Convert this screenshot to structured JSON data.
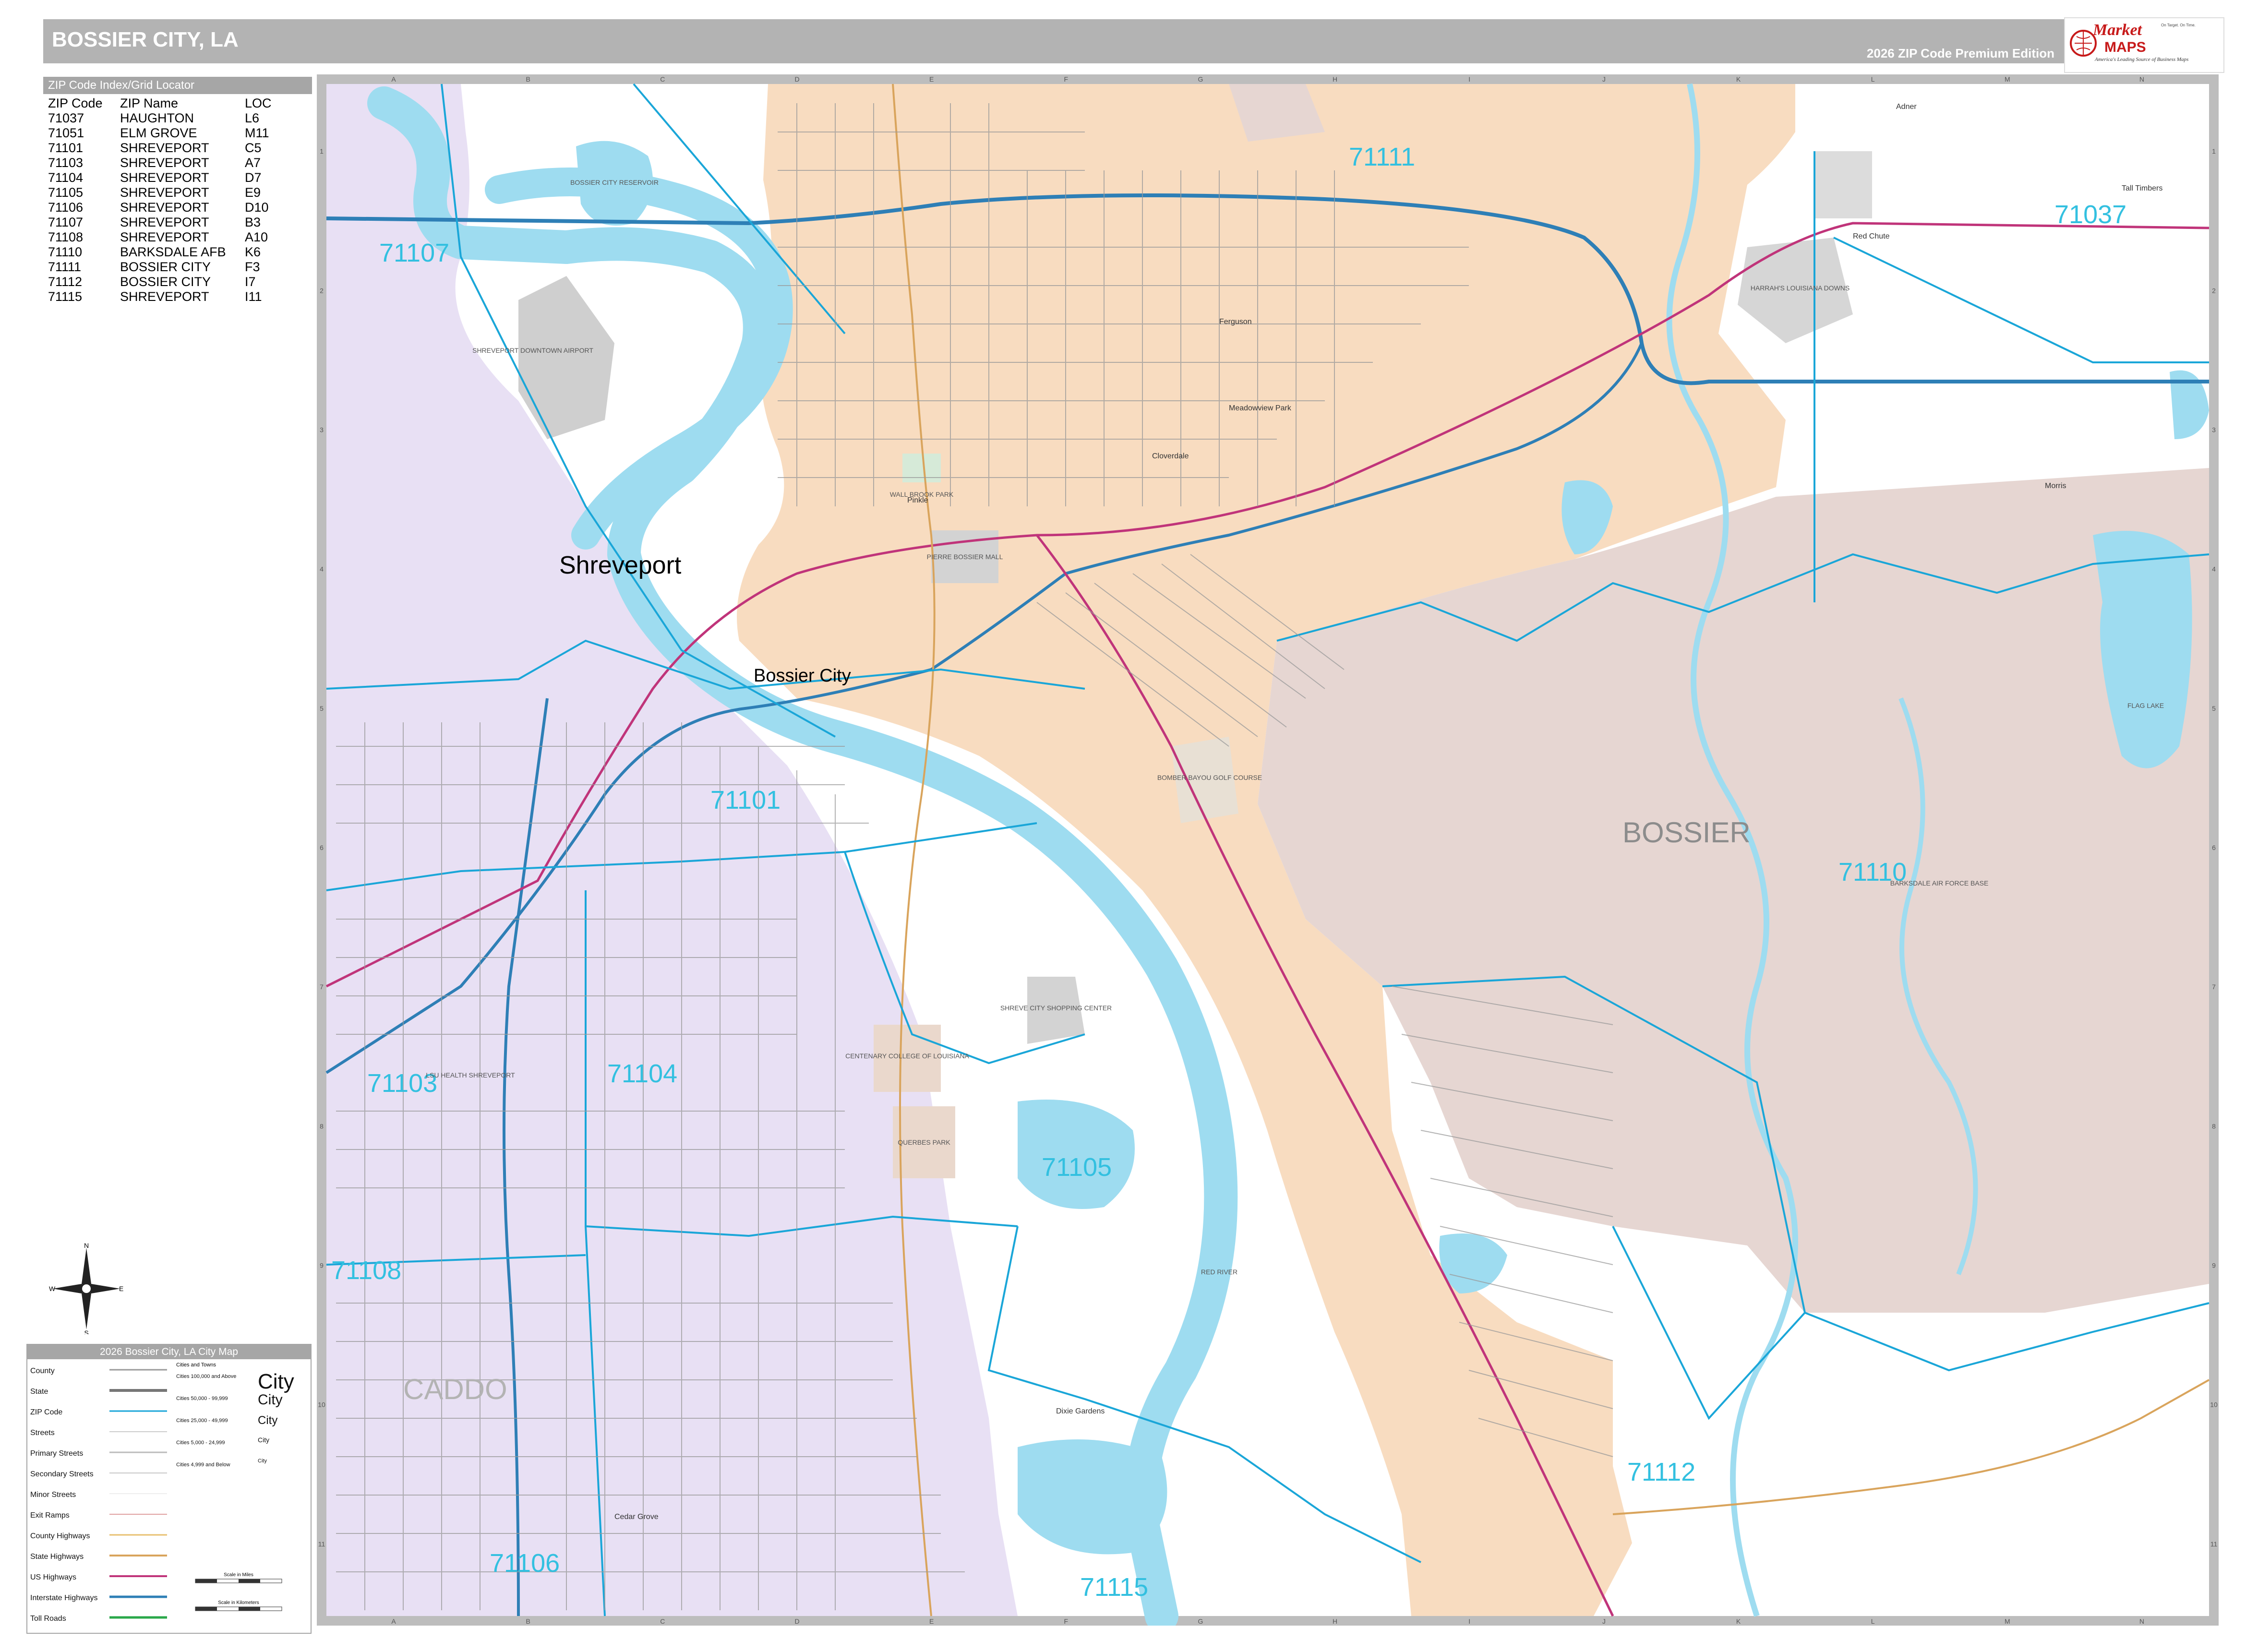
{
  "header": {
    "title": "BOSSIER CITY, LA",
    "edition": "2026 ZIP Code Premium Edition"
  },
  "brand": {
    "name_part1": "Market",
    "name_part2": "MAPS",
    "tagline": "America's Leading Source of Business Maps",
    "slogan": "On Target. On Time."
  },
  "zip_index": {
    "title": "ZIP Code Index/Grid Locator",
    "columns": [
      "ZIP Code",
      "ZIP Name",
      "LOC"
    ],
    "rows": [
      [
        "71037",
        "HAUGHTON",
        "L6"
      ],
      [
        "71051",
        "ELM GROVE",
        "M11"
      ],
      [
        "71101",
        "SHREVEPORT",
        "C5"
      ],
      [
        "71103",
        "SHREVEPORT",
        "A7"
      ],
      [
        "71104",
        "SHREVEPORT",
        "D7"
      ],
      [
        "71105",
        "SHREVEPORT",
        "E9"
      ],
      [
        "71106",
        "SHREVEPORT",
        "D10"
      ],
      [
        "71107",
        "SHREVEPORT",
        "B3"
      ],
      [
        "71108",
        "SHREVEPORT",
        "A10"
      ],
      [
        "71110",
        "BARKSDALE AFB",
        "K6"
      ],
      [
        "71111",
        "BOSSIER CITY",
        "F3"
      ],
      [
        "71112",
        "BOSSIER CITY",
        "I7"
      ],
      [
        "71115",
        "SHREVEPORT",
        "I11"
      ]
    ]
  },
  "map": {
    "colors": {
      "water": "#9edcf0",
      "shreveport_area": "#e8e0f4",
      "bossier_city_area": "#f8dcc0",
      "base_area": "#e6d6d2",
      "zip_boundary": "#1aa6d8",
      "interstate": "#2e7fb6",
      "us_highway": "#c0347a",
      "state_highway": "#d9a45c",
      "street": "#8c8c8c"
    },
    "grid_columns": [
      "A",
      "B",
      "C",
      "D",
      "E",
      "F",
      "G",
      "H",
      "I",
      "J",
      "K",
      "L",
      "M",
      "N"
    ],
    "grid_rows": [
      "1",
      "2",
      "3",
      "4",
      "5",
      "6",
      "7",
      "8",
      "9",
      "10",
      "11"
    ],
    "zip_labels": [
      "71111",
      "71037",
      "71107",
      "71101",
      "71110",
      "71103",
      "71104",
      "71105",
      "71108",
      "71112",
      "71106",
      "71115"
    ],
    "city_labels": [
      "Shreveport",
      "Bossier City"
    ],
    "county_labels": [
      "BOSSIER",
      "CADDO"
    ],
    "place_labels": [
      "Ferguson",
      "Meadowview Park",
      "Cloverdale",
      "Dixie Gardens",
      "Cedar Grove",
      "Red Chute",
      "Adner",
      "Tall Timbers",
      "Morris",
      "Pinkle"
    ],
    "landmark_labels": [
      "SHREVEPORT DOWNTOWN AIRPORT",
      "BOSSIER CITY RESERVOIR",
      "HARRAH'S LOUISIANA DOWNS",
      "BARKSDALE AIR FORCE BASE",
      "FLAG LAKE",
      "BOMBER BAYOU GOLF COURSE",
      "WALL BROOK PARK",
      "PIERRE BOSSIER MALL",
      "CENTENARY COLLEGE OF LOUISIANA",
      "SHREVE CITY SHOPPING CENTER",
      "QUERBES PARK",
      "LSU HEALTH SHREVEPORT",
      "RED RIVER"
    ]
  },
  "compass": {
    "north": "N",
    "south": "S",
    "east": "E",
    "west": "W"
  },
  "legend": {
    "title": "2026 Bossier City, LA City Map",
    "items": [
      "County",
      "State",
      "ZIP Code",
      "Streets",
      "Primary Streets",
      "Secondary Streets",
      "Minor Streets",
      "Exit Ramps",
      "County Highways",
      "State Highways",
      "US Highways",
      "Interstate Highways",
      "Toll Roads"
    ],
    "cities_header": "Cities and Towns",
    "cities": [
      {
        "desc": "Cities 100,000 and Above",
        "sample": "City"
      },
      {
        "desc": "Cities 50,000 - 99,999",
        "sample": "City"
      },
      {
        "desc": "Cities 25,000 - 49,999",
        "sample": "City"
      },
      {
        "desc": "Cities 5,000 - 24,999",
        "sample": "City"
      },
      {
        "desc": "Cities 4,999 and Below",
        "sample": "City"
      }
    ],
    "scale_miles": "Scale in Miles",
    "scale_km": "Scale in Kilometers"
  }
}
